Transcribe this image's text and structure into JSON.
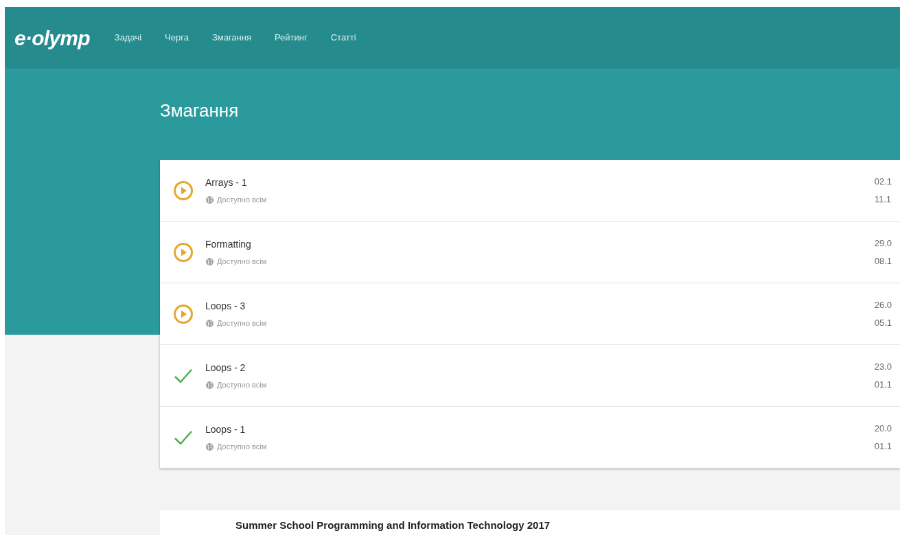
{
  "header": {
    "logo": "e·olymp",
    "nav": [
      {
        "label": "Задачі"
      },
      {
        "label": "Черга"
      },
      {
        "label": "Змагання"
      },
      {
        "label": "Рейтинг"
      },
      {
        "label": "Статті"
      }
    ]
  },
  "page_title": "Змагання",
  "contests": [
    {
      "kind": "running",
      "name": "Arrays - 1",
      "access": "Доступно всім",
      "start": "02.1",
      "end": "11.1"
    },
    {
      "kind": "running",
      "name": "Formatting",
      "access": "Доступно всім",
      "start": "29.0",
      "end": "08.1"
    },
    {
      "kind": "running",
      "name": "Loops - 3",
      "access": "Доступно всім",
      "start": "26.0",
      "end": "05.1"
    },
    {
      "kind": "finished",
      "name": "Loops - 2",
      "access": "Доступно всім",
      "start": "23.0",
      "end": "01.1"
    },
    {
      "kind": "finished",
      "name": "Loops - 1",
      "access": "Доступно всім",
      "start": "20.0",
      "end": "01.1"
    }
  ],
  "group_title": "Summer School Programming and Information Technology 2017"
}
